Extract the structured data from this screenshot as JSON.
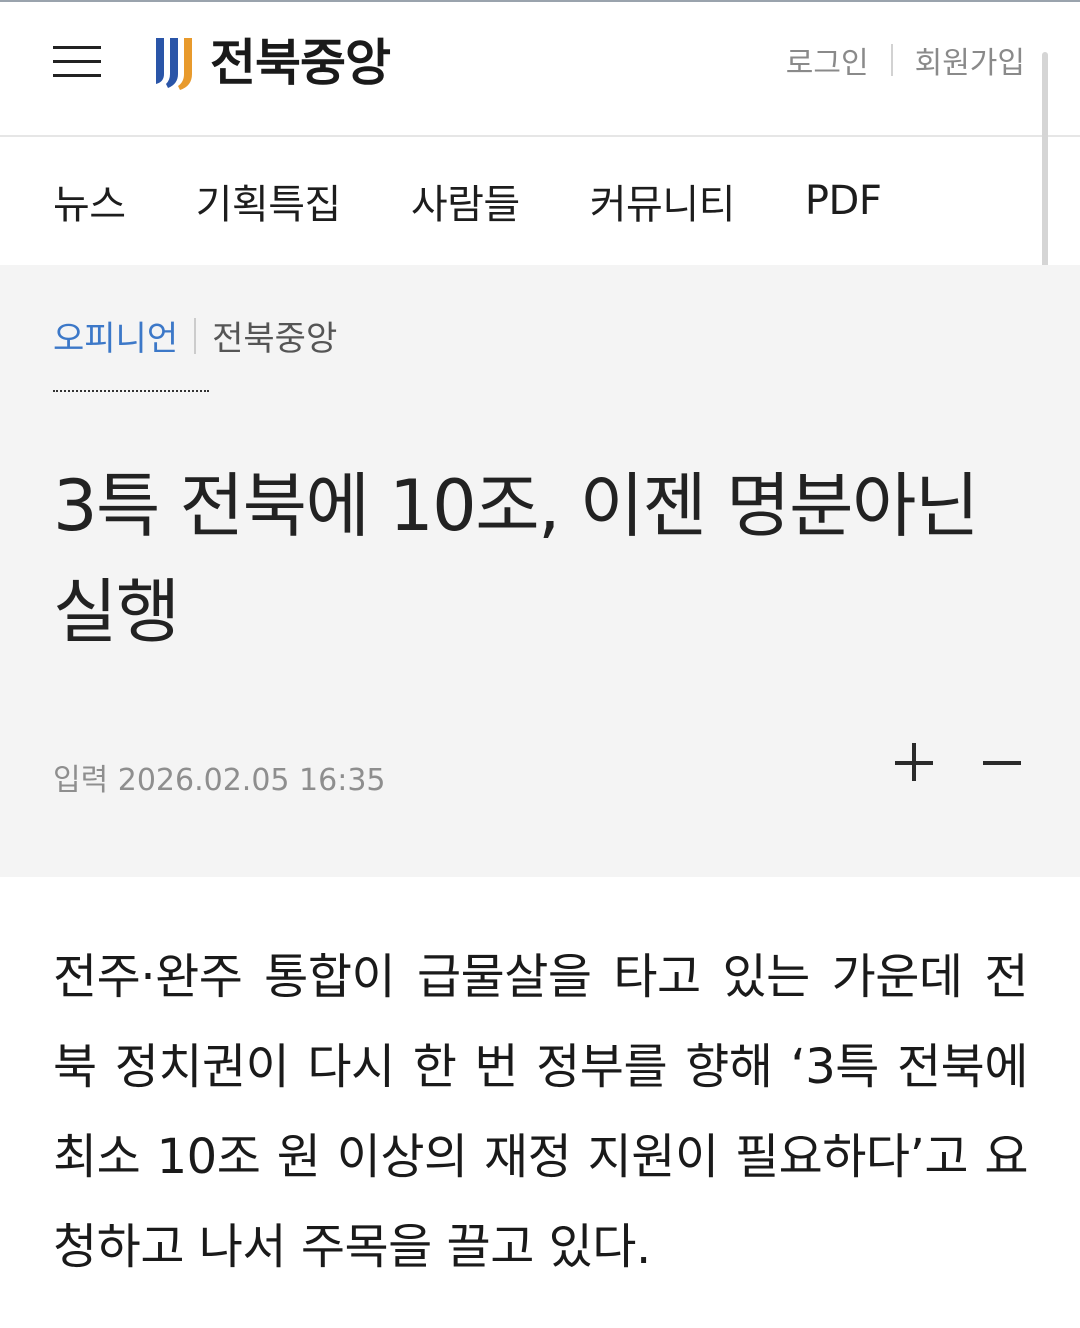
{
  "header": {
    "logo_text": "전북중앙",
    "login_label": "로그인",
    "signup_label": "회원가입",
    "accent_colors": {
      "logo_blue": "#2a55a8",
      "logo_orange": "#e89a2c"
    }
  },
  "nav": {
    "items": [
      {
        "label": "뉴스"
      },
      {
        "label": "기획특집"
      },
      {
        "label": "사람들"
      },
      {
        "label": "커뮤니티"
      },
      {
        "label": "PDF"
      }
    ]
  },
  "breadcrumb": {
    "section": "오피니언",
    "source": "전북중앙"
  },
  "article": {
    "headline": "3특 전북에 10조, 이젠 명분아닌 실행",
    "dateline": "입력 2026.02.05 16:35",
    "font_increase_icon": "plus-icon",
    "font_decrease_icon": "minus-icon",
    "body": "전주·완주 통합이 급물살을 타고 있는 가운데 전북 정치권이 다시 한 번 정부를 향해 ‘3특 전북에 최소 10조 원 이상의 재정 지원이 필요하다’고 요청하고 나서 주목을 끌고 있다."
  }
}
